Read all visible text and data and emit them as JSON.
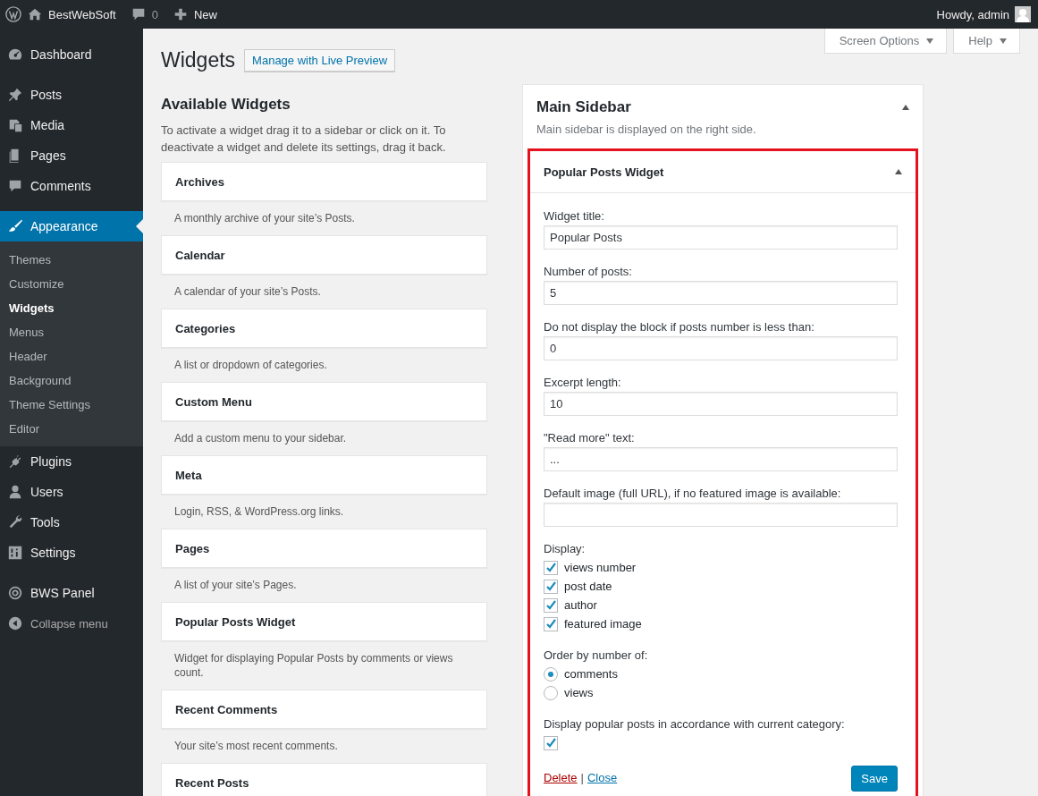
{
  "admin_bar": {
    "site": "BestWebSoft",
    "comments": "0",
    "new": "New",
    "greeting": "Howdy, admin"
  },
  "menu": [
    {
      "label": "Dashboard",
      "selected": false
    },
    {
      "label": "Posts",
      "selected": false
    },
    {
      "label": "Media",
      "selected": false
    },
    {
      "label": "Pages",
      "selected": false
    },
    {
      "label": "Comments",
      "selected": false
    },
    {
      "label": "Appearance",
      "selected": true,
      "children": [
        {
          "label": "Themes",
          "selected": false
        },
        {
          "label": "Customize",
          "selected": false
        },
        {
          "label": "Widgets",
          "selected": true
        },
        {
          "label": "Menus",
          "selected": false
        },
        {
          "label": "Header",
          "selected": false
        },
        {
          "label": "Background",
          "selected": false
        },
        {
          "label": "Theme Settings",
          "selected": false
        },
        {
          "label": "Editor",
          "selected": false
        }
      ]
    },
    {
      "label": "Plugins",
      "selected": false
    },
    {
      "label": "Users",
      "selected": false
    },
    {
      "label": "Tools",
      "selected": false
    },
    {
      "label": "Settings",
      "selected": false
    },
    {
      "label": "BWS Panel",
      "selected": false
    }
  ],
  "collapse": "Collapse menu",
  "page": {
    "title": "Widgets",
    "live_preview": "Manage with Live Preview",
    "screen_options": "Screen Options",
    "help": "Help"
  },
  "available": {
    "heading": "Available Widgets",
    "intro": "To activate a widget drag it to a sidebar or click on it. To deactivate a widget and delete its settings, drag it back.",
    "widgets": [
      {
        "name": "Archives",
        "description": "A monthly archive of your site’s Posts."
      },
      {
        "name": "Calendar",
        "description": "A calendar of your site’s Posts."
      },
      {
        "name": "Categories",
        "description": "A list or dropdown of categories."
      },
      {
        "name": "Custom Menu",
        "description": "Add a custom menu to your sidebar."
      },
      {
        "name": "Meta",
        "description": "Login, RSS, & WordPress.org links."
      },
      {
        "name": "Pages",
        "description": "A list of your site’s Pages."
      },
      {
        "name": "Popular Posts Widget",
        "description": "Widget for displaying Popular Posts by comments or views count."
      },
      {
        "name": "Recent Comments",
        "description": "Your site’s most recent comments."
      },
      {
        "name": "Recent Posts"
      }
    ]
  },
  "sidebar_area": {
    "title": "Main Sidebar",
    "description": "Main sidebar is displayed on the right side.",
    "expanded": true,
    "widget": {
      "title": "Popular Posts Widget",
      "expanded": true,
      "highlighted": true,
      "fields": [
        {
          "kind": "text",
          "label": "Widget title:",
          "value": "Popular Posts"
        },
        {
          "kind": "text",
          "label": "Number of posts:",
          "value": "5"
        },
        {
          "kind": "text",
          "label": "Do not display the block if posts number is less than:",
          "value": "0"
        },
        {
          "kind": "text",
          "label": "Excerpt length:",
          "value": "10"
        },
        {
          "kind": "text",
          "label": "\"Read more\" text:",
          "value": "..."
        },
        {
          "kind": "text",
          "label": "Default image (full URL), if no featured image is available:"
        },
        {
          "kind": "checkboxes",
          "label": "Display:",
          "options": [
            {
              "label": "views number",
              "checked": true
            },
            {
              "label": "post date",
              "checked": true
            },
            {
              "label": "author",
              "checked": true
            },
            {
              "label": "featured image",
              "checked": true
            }
          ]
        },
        {
          "kind": "radios",
          "label": "Order by number of:",
          "options": [
            {
              "label": "comments",
              "selected": true
            },
            {
              "label": "views",
              "selected": false
            }
          ]
        },
        {
          "kind": "checkbox",
          "label": "Display popular posts in accordance with current category:",
          "checked": true
        }
      ],
      "delete": "Delete",
      "separator": "|",
      "close": "Close",
      "save": "Save"
    }
  }
}
